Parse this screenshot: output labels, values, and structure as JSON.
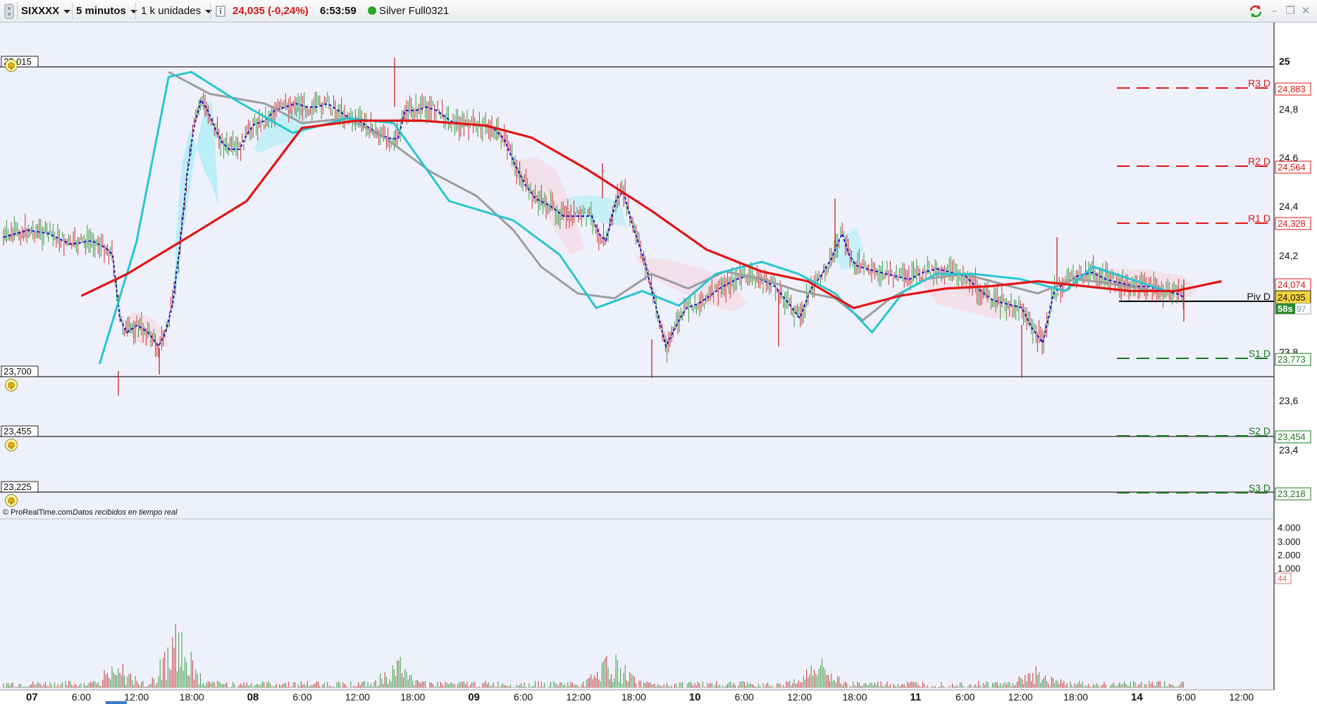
{
  "toolbar": {
    "symbol": "SIXXXX",
    "timeframe": "5 minutos",
    "units": "1 k unidades",
    "info_icon": "info-icon",
    "price_change": "24,035 (-0,24%)",
    "time": "6:53:59",
    "feed_status": "Silver Full0321",
    "status_color": "#22aa22"
  },
  "colors": {
    "red_line": "#e31414",
    "cyan_line": "#27c6d0",
    "gray_line": "#9d9d9d",
    "blue_dotted": "#1a1acc",
    "resistance": "#e31414",
    "support": "#1a7a1a",
    "cloud": "#a8eef5",
    "background": "#eef1fc"
  },
  "price_axis": {
    "ticks": [
      "25",
      "24,8",
      "24,6",
      "24,4",
      "24,2",
      "23,8",
      "23,6",
      "23,4"
    ],
    "current_price": "24,035",
    "countdown": "58s",
    "partial_badge": "97",
    "ma_value": "24,074"
  },
  "alert_levels": [
    {
      "value": "25,015"
    },
    {
      "value": "23,700"
    },
    {
      "value": "23,455"
    },
    {
      "value": "23,225"
    }
  ],
  "pivots": [
    {
      "label": "R3 D",
      "value": "24,883",
      "kind": "resistance"
    },
    {
      "label": "R2 D",
      "value": "24,564",
      "kind": "resistance"
    },
    {
      "label": "R1 D",
      "value": "24,328",
      "kind": "resistance"
    },
    {
      "label": "Piv D",
      "value": "",
      "kind": "pivot"
    },
    {
      "label": "S1 D",
      "value": "23,773",
      "kind": "support"
    },
    {
      "label": "S2 D",
      "value": "23,454",
      "kind": "support"
    },
    {
      "label": "S3 D",
      "value": "23,218",
      "kind": "support"
    }
  ],
  "copyright": {
    "brand": "© ProRealTime.com",
    "note": "Datos recibidos en tiempo real"
  },
  "volume_axis": {
    "ticks": [
      "4.000",
      "3.000",
      "2.000",
      "1.000"
    ],
    "current": "44"
  },
  "time_axis": {
    "labels": [
      "07",
      "6:00",
      "12:00",
      "18:00",
      "08",
      "6:00",
      "12:00",
      "18:00",
      "09",
      "6:00",
      "12:00",
      "18:00",
      "10",
      "6:00",
      "12:00",
      "18:00",
      "11",
      "6:00",
      "12:00",
      "18:00",
      "14",
      "6:00",
      "12:00"
    ],
    "bold": [
      true,
      false,
      false,
      false,
      true,
      false,
      false,
      false,
      true,
      false,
      false,
      false,
      true,
      false,
      false,
      false,
      true,
      false,
      false,
      false,
      true,
      false,
      false
    ]
  },
  "chart_data": {
    "type": "line",
    "y_range": [
      23.2,
      25.1
    ],
    "series": [
      {
        "name": "",
        "style": "red-thick",
        "points": [
          [
            0.6,
            24.03
          ],
          [
            1.1,
            24.12
          ],
          [
            1.8,
            24.28
          ],
          [
            2.4,
            24.42
          ],
          [
            3.0,
            24.72
          ],
          [
            3.6,
            24.75
          ],
          [
            4.3,
            24.75
          ],
          [
            5.0,
            24.73
          ],
          [
            5.5,
            24.68
          ],
          [
            6.1,
            24.55
          ],
          [
            6.8,
            24.38
          ],
          [
            7.4,
            24.22
          ],
          [
            8.0,
            24.13
          ],
          [
            8.5,
            24.09
          ],
          [
            9.0,
            23.98
          ],
          [
            9.5,
            24.03
          ],
          [
            10.0,
            24.06
          ],
          [
            10.5,
            24.07
          ],
          [
            11.0,
            24.09
          ],
          [
            11.5,
            24.07
          ],
          [
            12.0,
            24.05
          ],
          [
            12.5,
            24.05
          ],
          [
            13.0,
            24.09
          ]
        ]
      },
      {
        "name": "",
        "style": "cyan",
        "points": [
          [
            0.8,
            23.75
          ],
          [
            1.2,
            24.25
          ],
          [
            1.55,
            24.93
          ],
          [
            1.8,
            24.95
          ],
          [
            2.3,
            24.83
          ],
          [
            2.9,
            24.7
          ],
          [
            3.5,
            24.76
          ],
          [
            4.0,
            24.74
          ],
          [
            4.6,
            24.42
          ],
          [
            5.3,
            24.34
          ],
          [
            5.8,
            24.2
          ],
          [
            6.2,
            23.98
          ],
          [
            6.7,
            24.05
          ],
          [
            7.1,
            23.99
          ],
          [
            7.5,
            24.12
          ],
          [
            8.0,
            24.17
          ],
          [
            8.4,
            24.12
          ],
          [
            8.8,
            24.04
          ],
          [
            9.2,
            23.88
          ],
          [
            9.55,
            24.05
          ],
          [
            9.9,
            24.12
          ],
          [
            10.3,
            24.12
          ],
          [
            10.8,
            24.1
          ],
          [
            11.3,
            24.05
          ],
          [
            11.6,
            24.15
          ],
          [
            12.0,
            24.1
          ],
          [
            12.4,
            24.05
          ]
        ]
      },
      {
        "name": "",
        "style": "gray",
        "points": [
          [
            1.55,
            24.95
          ],
          [
            2.0,
            24.86
          ],
          [
            2.6,
            24.82
          ],
          [
            3.0,
            24.74
          ],
          [
            3.5,
            24.76
          ],
          [
            3.9,
            24.68
          ],
          [
            4.4,
            24.54
          ],
          [
            4.9,
            24.44
          ],
          [
            5.3,
            24.3
          ],
          [
            5.6,
            24.15
          ],
          [
            6.0,
            24.04
          ],
          [
            6.4,
            24.02
          ],
          [
            6.8,
            24.12
          ],
          [
            7.2,
            24.06
          ],
          [
            7.6,
            24.13
          ],
          [
            8.0,
            24.1
          ],
          [
            8.4,
            24.05
          ],
          [
            8.8,
            24.02
          ],
          [
            9.1,
            23.93
          ],
          [
            9.4,
            24.02
          ],
          [
            9.8,
            24.1
          ],
          [
            10.2,
            24.12
          ],
          [
            10.6,
            24.08
          ],
          [
            11.0,
            24.04
          ],
          [
            11.4,
            24.1
          ],
          [
            11.8,
            24.08
          ],
          [
            12.3,
            24.05
          ]
        ]
      }
    ]
  }
}
